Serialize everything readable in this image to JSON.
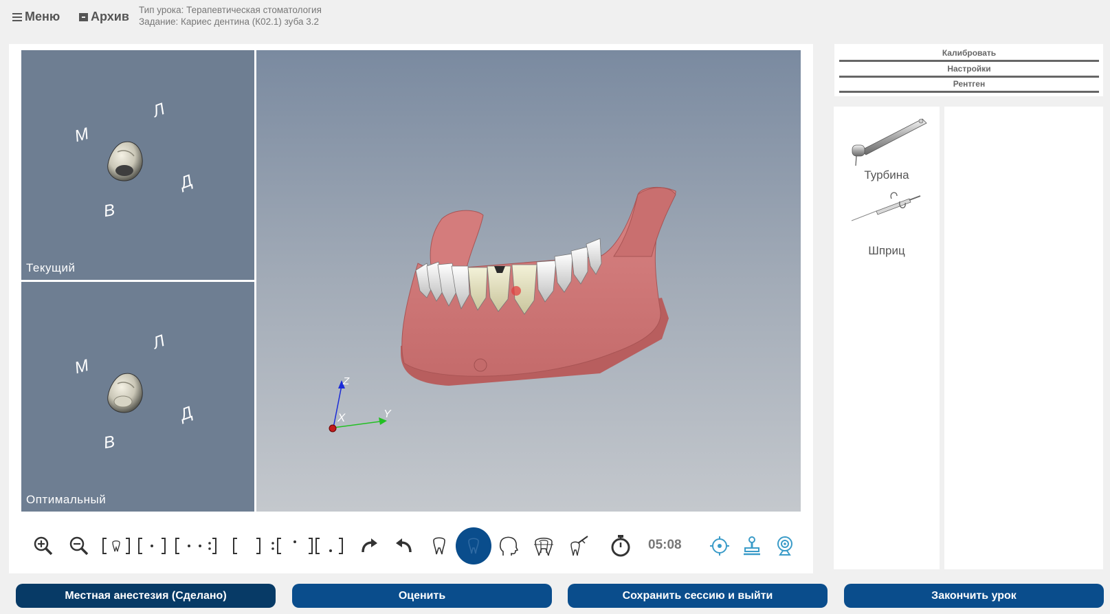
{
  "header": {
    "menu_label": "Меню",
    "archive_label": "Архив",
    "lesson_type": "Тип урока: Терапевтическая стоматология",
    "task": "Задание: Кариес дентина (К02.1) зуба 3.2"
  },
  "views": {
    "current_label": "Текущий",
    "optimal_label": "Оптимальный",
    "directions": {
      "lingual": "Л",
      "mesial": "М",
      "distal": "Д",
      "vestibular": "В"
    }
  },
  "axes": {
    "x": "X",
    "y": "Y",
    "z": "Z"
  },
  "toolbar": {
    "icons": [
      "zoom-in-icon",
      "zoom-out-icon",
      "frame-tooth-icon",
      "frame-dot-icon",
      "frame-dots-icon",
      "frame-empty-icon",
      "frame-dots-alt-icon",
      "frame-dot-low-icon",
      "redo-icon",
      "undo-icon",
      "tooth-icon",
      "tooth-active-icon",
      "head-icon",
      "tooth-section-icon",
      "tooth-tool-icon",
      "stopwatch-icon",
      "target-icon",
      "stamp-icon",
      "webcam-icon"
    ],
    "timer": "05:08"
  },
  "side": {
    "calibrate": "Калибровать",
    "settings": "Настройки",
    "xray": "Рентген"
  },
  "tools": [
    {
      "label": "Турбина",
      "icon": "turbine-handpiece-icon"
    },
    {
      "label": "Шприц",
      "icon": "syringe-icon"
    }
  ],
  "bottom": {
    "anesthesia": "Местная анестезия (Сделано)",
    "evaluate": "Оценить",
    "save_exit": "Сохранить сессию и выйти",
    "finish": "Закончить урок"
  },
  "colors": {
    "accent": "#0a4d8c",
    "accent_dark": "#073a66",
    "viewport": "#6e7e92",
    "icon_blue": "#3a9bc8"
  }
}
